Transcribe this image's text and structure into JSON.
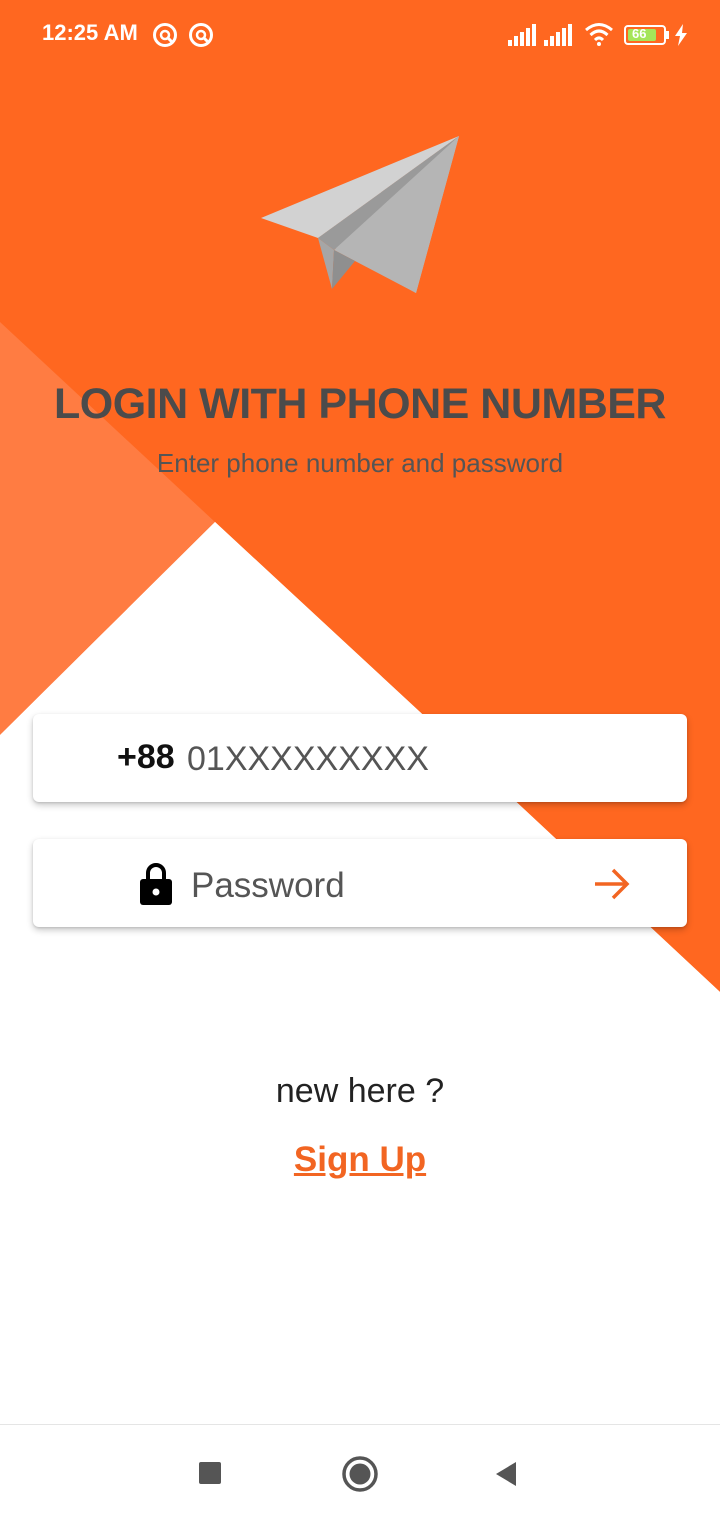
{
  "status_bar": {
    "time": "12:25 AM",
    "battery_level": "66"
  },
  "header": {
    "title": "LOGIN WITH PHONE NUMBER",
    "subtitle": "Enter phone number and password"
  },
  "form": {
    "phone_prefix": "+88",
    "phone_placeholder": "01XXXXXXXXX",
    "password_placeholder": "Password"
  },
  "footer": {
    "new_here": "new here ?",
    "signup_label": "Sign Up"
  },
  "colors": {
    "accent": "#ff6720",
    "light_accent": "#ff7c42",
    "text_dark": "#4b4b4b"
  },
  "icons": [
    "paper-plane-logo",
    "lock-icon",
    "arrow-right-icon",
    "recents-icon",
    "home-icon",
    "back-icon"
  ]
}
